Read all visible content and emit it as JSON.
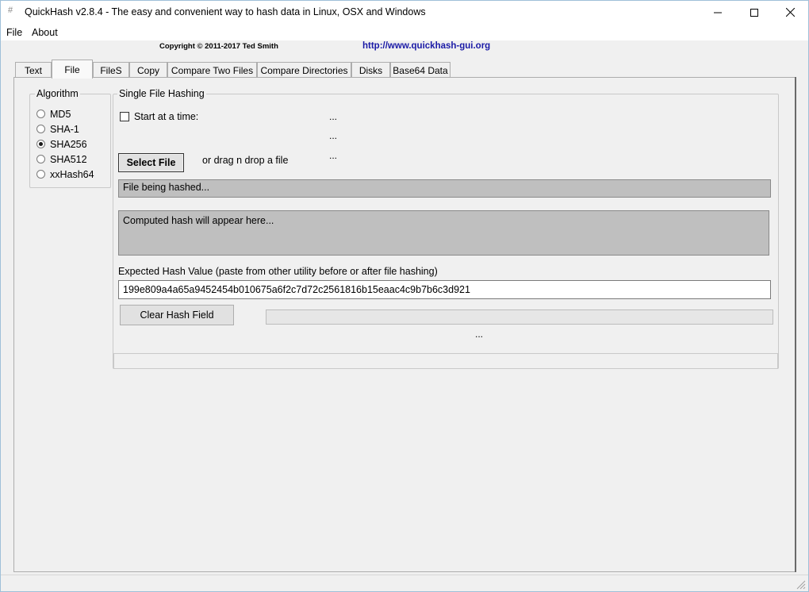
{
  "window": {
    "title": "QuickHash v2.8.4 - The easy and convenient way to hash data in Linux, OSX and Windows",
    "app_icon_glyph": "#",
    "minimize_icon": "minimize-icon",
    "maximize_icon": "maximize-icon",
    "close_icon": "close-icon"
  },
  "menu": {
    "items": [
      {
        "label": "File"
      },
      {
        "label": "About"
      }
    ]
  },
  "header": {
    "copyright": "Copyright © 2011-2017  Ted Smith",
    "link": "http://www.quickhash-gui.org",
    "link_color": "#1a1aa6"
  },
  "tabs": [
    {
      "label": "Text",
      "active": false
    },
    {
      "label": "File",
      "active": true
    },
    {
      "label": "FileS",
      "active": false
    },
    {
      "label": "Copy",
      "active": false
    },
    {
      "label": "Compare Two Files",
      "active": false
    },
    {
      "label": "Compare Directories",
      "active": false
    },
    {
      "label": "Disks",
      "active": false
    },
    {
      "label": "Base64 Data",
      "active": false
    }
  ],
  "algorithm": {
    "caption": "Algorithm",
    "selected": "SHA256",
    "options": [
      {
        "label": "MD5",
        "checked": false
      },
      {
        "label": "SHA-1",
        "checked": false
      },
      {
        "label": "SHA256",
        "checked": true
      },
      {
        "label": "SHA512",
        "checked": false
      },
      {
        "label": "xxHash64",
        "checked": false
      }
    ]
  },
  "single_file": {
    "caption": "Single File Hashing",
    "start_at_time_label": "Start at a time:",
    "start_at_time_checked": false,
    "info_lines": [
      "...",
      "...",
      "..."
    ],
    "select_file_label": "Select File",
    "drag_drop_label": "or drag n drop a file",
    "file_being_hashed": "File being hashed...",
    "computed_hash": "Computed hash will appear here...",
    "expected_hash_label": "Expected Hash Value (paste from other utility before or after file hashing)",
    "expected_hash_value": "199e809a4a65a9452454b010675a6f2c7d72c2561816b15eaac4c9b7b6c3d921",
    "clear_hash_label": "Clear Hash Field",
    "progress_percent": 0,
    "progress_status": "..."
  },
  "colors": {
    "window_bg": "#f0f0f0",
    "gray_field": "#bfbfbf",
    "link": "#1a1aa6"
  }
}
